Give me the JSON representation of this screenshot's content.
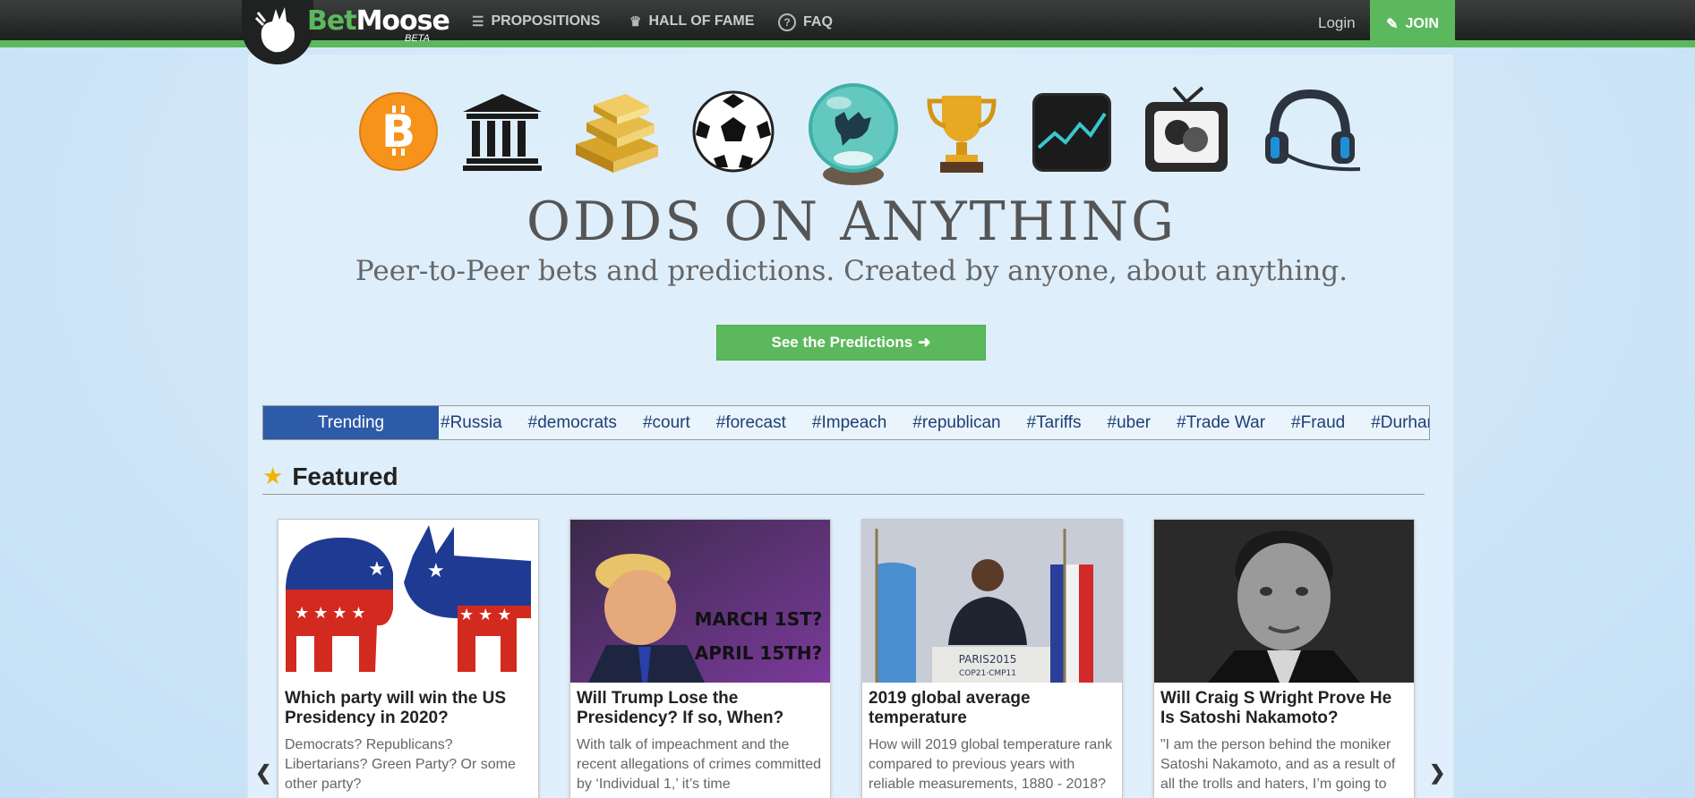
{
  "nav": {
    "brand_bet": "Bet",
    "brand_moose": "Moose",
    "brand_beta": "BETA",
    "items": [
      {
        "label": "PROPOSITIONS",
        "icon": "coins-stack-icon"
      },
      {
        "label": "HALL OF FAME",
        "icon": "trophy-cup-icon"
      },
      {
        "label": "FAQ",
        "icon": "question-circle-icon"
      }
    ],
    "login": "Login",
    "join": "JOIN",
    "join_icon": "edit-icon"
  },
  "hero": {
    "categories": [
      "bitcoin-icon",
      "government-icon",
      "gold-bars-icon",
      "soccer-ball-icon",
      "crystal-ball-icon",
      "trophy-icon",
      "stock-chart-icon",
      "tv-theater-icon",
      "gaming-headset-icon"
    ],
    "headline": "ODDS ON ANYTHING",
    "subline": "Peer-to-Peer bets and predictions. Created by anyone, about anything.",
    "cta": "See the Predictions"
  },
  "trending": {
    "label": "Trending",
    "tags": [
      "#Russia",
      "#democrats",
      "#court",
      "#forecast",
      "#Impeach",
      "#republican",
      "#Tariffs",
      "#uber",
      "#Trade War",
      "#Fraud",
      "#Durham"
    ]
  },
  "featured": {
    "heading": "Featured",
    "cards": [
      {
        "title": "Which party will win the US Presidency in 2020?",
        "description": "Democrats? Republicans? Libertarians? Green Party? Or some other party?"
      },
      {
        "title": "Will Trump Lose the Presidency? If so, When?",
        "description": "With talk of impeachment and the recent allegations of crimes committed by ‘Individual 1,’ it’s time",
        "image_text_1": "MARCH 1ST?",
        "image_text_2": "APRIL 15TH?"
      },
      {
        "title": "2019 global average temperature",
        "description": "How will 2019 global temperature rank compared to previous years with reliable measurements, 1880 - 2018?",
        "image_text_1": "PARIS2015",
        "image_text_2": "COP21·CMP11"
      },
      {
        "title": "Will Craig S Wright Prove He Is Satoshi Nakamoto?",
        "description": "\"I am the person behind the moniker Satoshi Nakamoto, and as a result of all the trolls and haters, I’m going to"
      }
    ]
  },
  "colors": {
    "accent_green": "#5cb85c",
    "trending_blue": "#2e5ba8",
    "navbar_dark": "#1d201f"
  }
}
